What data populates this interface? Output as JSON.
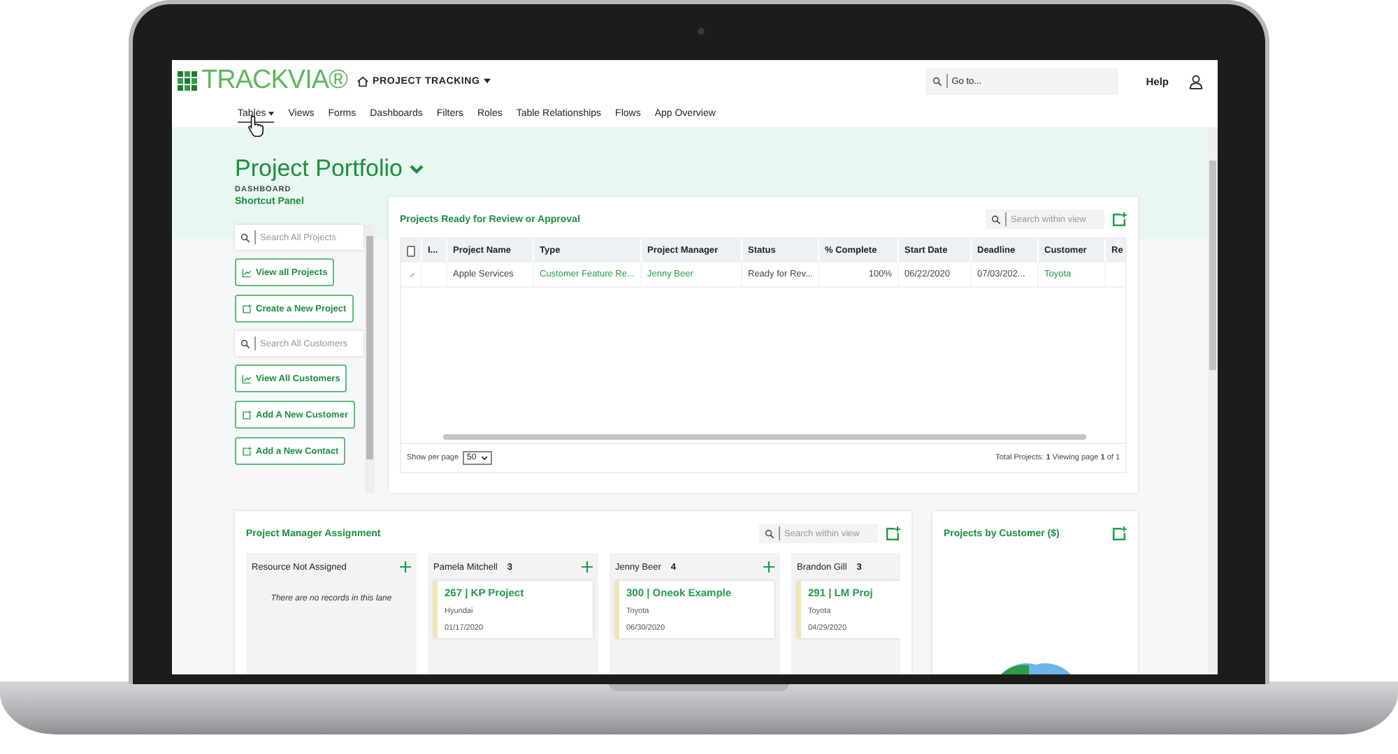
{
  "app": {
    "logo": "TRACKVIA®",
    "app_name": "PROJECT TRACKING",
    "goto_placeholder": "Go to...",
    "help": "Help"
  },
  "nav": [
    {
      "label": "Tables",
      "selected": true,
      "has_menu": true
    },
    {
      "label": "Views",
      "selected": false,
      "has_menu": false
    },
    {
      "label": "Forms",
      "selected": false,
      "has_menu": false
    },
    {
      "label": "Dashboards",
      "selected": false,
      "has_menu": false
    },
    {
      "label": "Filters",
      "selected": false,
      "has_menu": false
    },
    {
      "label": "Roles",
      "selected": false,
      "has_menu": false
    },
    {
      "label": "Table Relationships",
      "selected": false,
      "has_menu": false
    },
    {
      "label": "Flows",
      "selected": false,
      "has_menu": false
    },
    {
      "label": "App Overview",
      "selected": false,
      "has_menu": false
    }
  ],
  "page": {
    "title": "Project Portfolio",
    "subtitle": "DASHBOARD"
  },
  "shortcut_panel": {
    "title": "Shortcut Panel",
    "items": [
      {
        "kind": "search",
        "placeholder": "Search All Projects"
      },
      {
        "kind": "view",
        "text": "View all Projects"
      },
      {
        "kind": "create",
        "text": "Create a New Project"
      },
      {
        "kind": "search",
        "placeholder": "Search All Customers"
      },
      {
        "kind": "view",
        "text": "View All Customers"
      },
      {
        "kind": "create",
        "text": "Add A New Customer"
      },
      {
        "kind": "create",
        "text": "Add a New Contact"
      }
    ]
  },
  "review_table": {
    "title": "Projects Ready for Review or Approval",
    "search_placeholder": "Search within view",
    "header_checked": false,
    "columns": [
      "I...",
      "Project Name",
      "Type",
      "Project Manager",
      "Status",
      "% Complete",
      "Start Date",
      "Deadline",
      "Customer",
      "Re"
    ],
    "rows": [
      {
        "cells": [
          {
            "text": ""
          },
          {
            "text": "Apple Services",
            "link": false
          },
          {
            "text": "Customer Feature Re...",
            "link": true
          },
          {
            "text": "Jenny Beer",
            "link": true
          },
          {
            "text": "Ready for Rev...",
            "link": false
          },
          {
            "text": "100%",
            "link": false,
            "numeric": true
          },
          {
            "text": "06/22/2020",
            "link": false
          },
          {
            "text": "07/03/202...",
            "link": false
          },
          {
            "text": "Toyota",
            "link": true
          }
        ]
      }
    ],
    "per_page_label": "Show per page",
    "per_page": "50",
    "summary": "Total Projects: **1**  Viewing page **1** of 1"
  },
  "assignment_board": {
    "title": "Project Manager Assignment",
    "search_placeholder": "Search within view",
    "lanes": [
      {
        "name": "Resource Not Assigned",
        "show_add": true,
        "empty_text": "There are no records in this lane"
      },
      {
        "name": "Pamela Mitchell",
        "count": "3",
        "show_add": true,
        "cards": [
          {
            "title": "267 | KP Project",
            "customer": "Hyundai",
            "date": "01/17/2020"
          }
        ]
      },
      {
        "name": "Jenny Beer",
        "count": "4",
        "show_add": true,
        "cards": [
          {
            "title": "300 | Oneok Example",
            "customer": "Toyota",
            "date": "06/30/2020"
          }
        ]
      },
      {
        "name": "Brandon Gill",
        "count": "3",
        "show_add": false,
        "cards": [
          {
            "title": "291 | LM Proj",
            "customer": "Toyota",
            "date": "04/29/2020"
          }
        ]
      }
    ]
  },
  "customer_chart": {
    "title": "Projects by Customer ($)"
  }
}
